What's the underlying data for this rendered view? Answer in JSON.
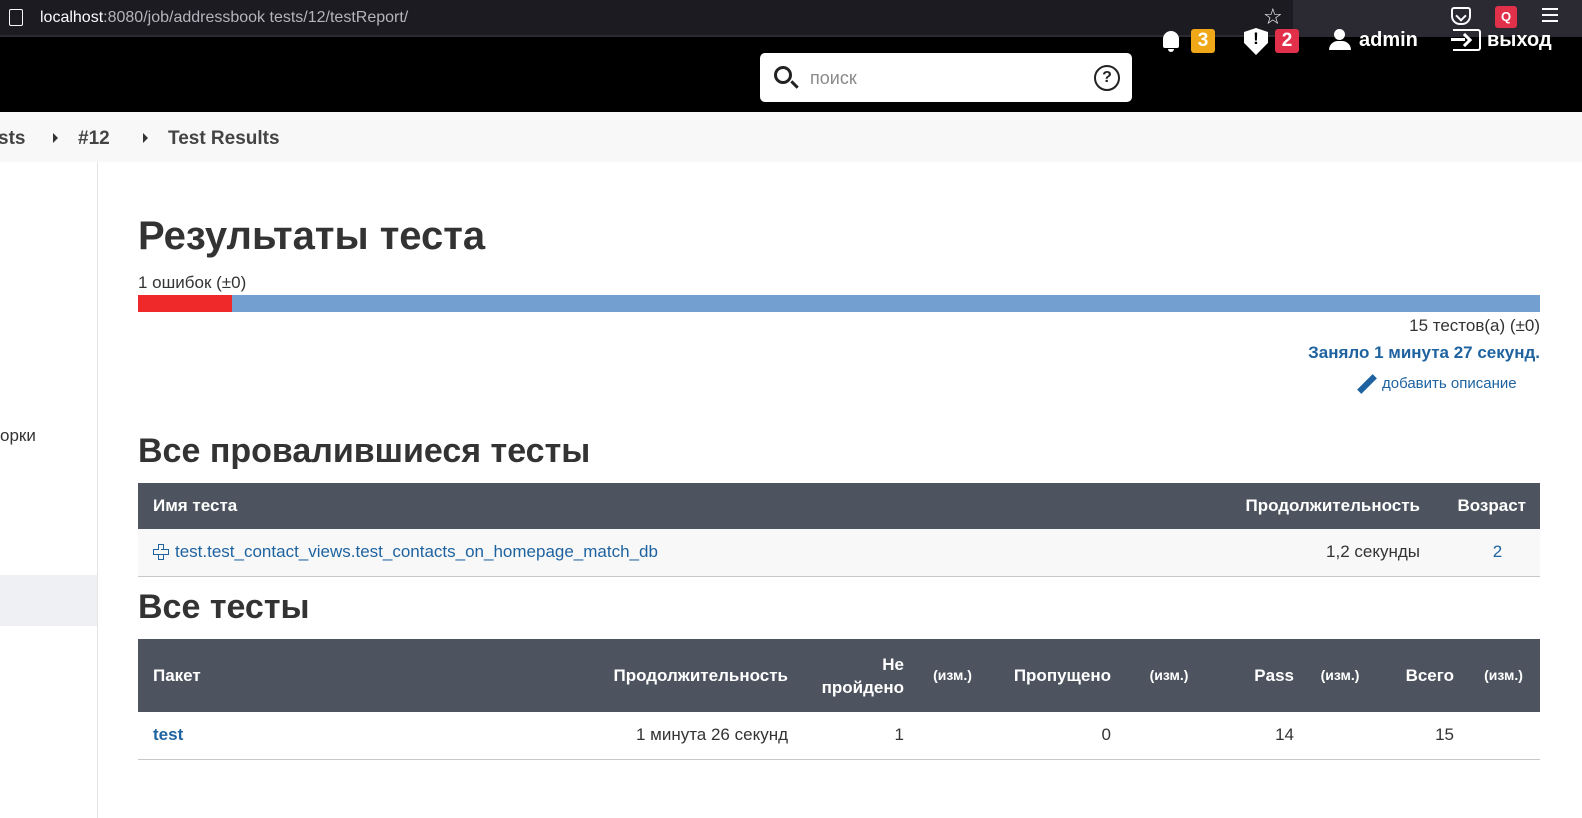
{
  "browser": {
    "url_host": "localhost",
    "url_rest": ":8080/job/addressbook tests/12/testReport/"
  },
  "header": {
    "search_placeholder": "поиск",
    "notifications_count": "3",
    "security_count": "2",
    "user_name": "admin",
    "logout_label": "выход"
  },
  "breadcrumb": {
    "items": [
      "sts",
      "#12",
      "Test Results"
    ]
  },
  "side_panel": {
    "partial_item": "орки"
  },
  "report": {
    "title": "Результаты теста",
    "fail_summary": "1 ошибок (±0)",
    "fail_fraction": 0.0667,
    "tests_total": "15 тестов(а) (±0)",
    "duration": "Заняло 1 минута 27 секунд.",
    "add_description": "добавить описание"
  },
  "failed_section": {
    "title": "Все провалившиеся тесты",
    "columns": [
      "Имя теста",
      "Продолжительность",
      "Возраст"
    ],
    "rows": [
      {
        "name": "test.test_contact_views.test_contacts_on_homepage_match_db",
        "duration": "1,2 секунды",
        "age": "2"
      }
    ]
  },
  "all_section": {
    "title": "Все тесты",
    "columns": [
      "Пакет",
      "Продолжительность",
      "Не пройдено",
      "(изм.)",
      "Пропущено",
      "(изм.)",
      "Pass",
      "(изм.)",
      "Всего",
      "(изм.)"
    ],
    "rows": [
      {
        "package": "test",
        "duration": "1 минута 26 секунд",
        "failed": "1",
        "failed_diff": "",
        "skipped": "0",
        "skipped_diff": "",
        "pass": "14",
        "pass_diff": "",
        "total": "15",
        "total_diff": ""
      }
    ]
  }
}
